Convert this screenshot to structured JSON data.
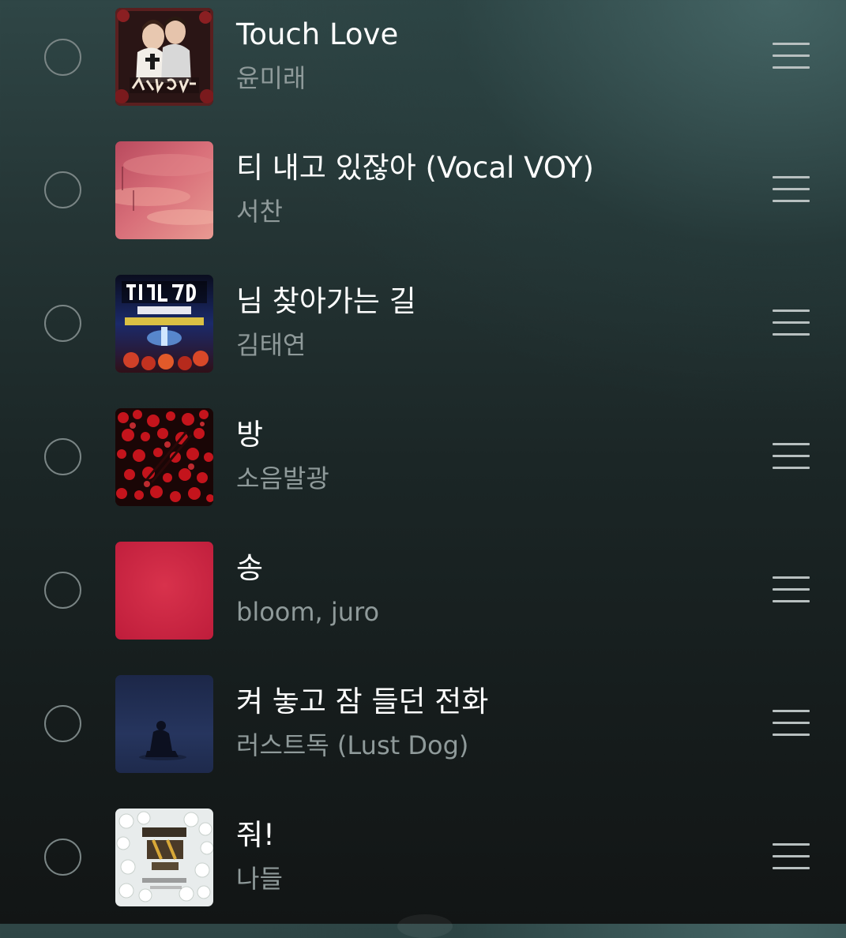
{
  "playlist": {
    "items": [
      {
        "title": "Touch Love",
        "artist": "윤미래",
        "art_icon": "album-art-touch-love"
      },
      {
        "title": "티 내고 있잖아 (Vocal VOY)",
        "artist": "서찬",
        "art_icon": "album-art-pink-clouds"
      },
      {
        "title": "님 찾아가는 길",
        "artist": "김태연",
        "art_icon": "album-art-hyeonyeok-gawang-3"
      },
      {
        "title": "방",
        "artist": "소음발광",
        "art_icon": "album-art-red-flowers"
      },
      {
        "title": "송",
        "artist": "bloom, juro",
        "art_icon": "album-art-red-solid"
      },
      {
        "title": "켜 놓고 잠 들던 전화",
        "artist": "러스트독 (Lust Dog)",
        "art_icon": "album-art-blue-silhouette"
      },
      {
        "title": "줘!",
        "artist": "나들",
        "art_icon": "album-art-white-flowers"
      }
    ]
  },
  "colors": {
    "title_text": "#ffffff",
    "artist_text": "#8f9a9a",
    "checkbox_ring": "#7a8585",
    "drag_handle": "#b8c0c0",
    "background_top": "#2f4646",
    "background_bottom": "#121515"
  },
  "icons": {
    "select": "circle-checkbox-icon",
    "reorder": "drag-handle-icon"
  }
}
